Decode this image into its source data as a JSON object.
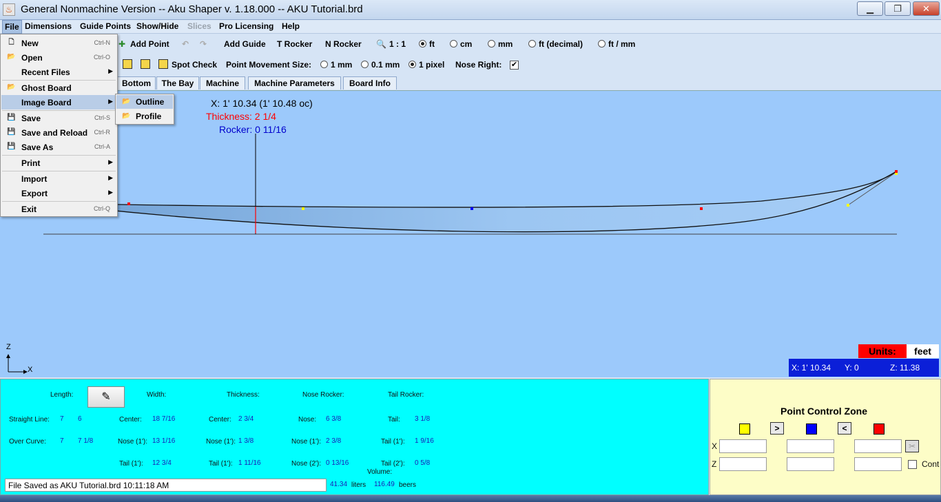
{
  "window": {
    "title": "General Nonmachine Version -- Aku Shaper v. 1.18.000  --  AKU Tutorial.brd",
    "minimize_icon": "minimize-icon",
    "maximize_icon": "restore-icon",
    "close_icon": "close-icon"
  },
  "menubar": {
    "items": [
      "File",
      "Dimensions",
      "Guide Points",
      "Show/Hide",
      "Slices",
      "Pro Licensing",
      "Help"
    ]
  },
  "toolbar1": {
    "add_point": "Add Point",
    "add_guide": "Add Guide",
    "t_rocker": "T Rocker",
    "n_rocker": "N Rocker",
    "zoom": "1 : 1",
    "units": [
      "ft",
      "cm",
      "mm",
      "ft (decimal)",
      "ft / mm"
    ],
    "selected_unit": "ft"
  },
  "toolbar2": {
    "spot_check": "Spot Check",
    "point_movement_label": "Point Movement Size:",
    "movement_options": [
      "1 mm",
      "0.1 mm",
      "1 pixel"
    ],
    "selected_movement": "1 pixel",
    "nose_right_label": "Nose Right:",
    "nose_right_checked": true
  },
  "tabs": [
    "Bottom",
    "The Bay",
    "Machine",
    "Machine Parameters",
    "Board Info"
  ],
  "canvas": {
    "x_readout": "X: 1' 10.34 (1' 10.48 oc)",
    "thickness_readout": "Thickness: 2 1/4",
    "rocker_readout": "Rocker: 0 11/16",
    "axis_z": "Z",
    "axis_x": "X",
    "units_label": "Units:",
    "units_value": "feet",
    "coord_x": "X: 1' 10.34",
    "coord_y": "Y: 0",
    "coord_z": "Z: 11.38"
  },
  "info": {
    "length_label": "Length:",
    "width_label": "Width:",
    "thickness_label": "Thickness:",
    "nose_rocker_label": "Nose Rocker:",
    "tail_rocker_label": "Tail Rocker:",
    "straight_line_label": "Straight Line:",
    "straight_line_a": "7",
    "straight_line_b": "6",
    "over_curve_label": "Over Curve:",
    "over_curve_a": "7",
    "over_curve_b": "7 1/8",
    "width_center_label": "Center:",
    "width_center": "18 7/16",
    "width_nose_label": "Nose (1'):",
    "width_nose": "13 1/16",
    "width_tail_label": "Tail (1'):",
    "width_tail": "12 3/4",
    "thick_center_label": "Center:",
    "thick_center": "2 3/4",
    "thick_nose_label": "Nose (1'):",
    "thick_nose": "1 3/8",
    "thick_tail_label": "Tail (1'):",
    "thick_tail": "1 11/16",
    "nrock_nose_label": "Nose:",
    "nrock_nose": "6 3/8",
    "nrock_nose1_label": "Nose (1'):",
    "nrock_nose1": "2 3/8",
    "nrock_nose2_label": "Nose (2'):",
    "nrock_nose2": "0 13/16",
    "trock_tail_label": "Tail:",
    "trock_tail": "3 1/8",
    "trock_tail1_label": "Tail (1'):",
    "trock_tail1": "1 9/16",
    "trock_tail2_label": "Tail (2'):",
    "trock_tail2": "0 5/8",
    "volume_label": "Volume:",
    "volume_liters": "41.34",
    "liters_label": "liters",
    "volume_beers": "116.49",
    "beers_label": "beers",
    "status": "File Saved as  AKU Tutorial.brd   10:11:18 AM"
  },
  "pcz": {
    "title": "Point Control Zone",
    "x_label": "X",
    "z_label": "Z",
    "cont_label": "Cont",
    "colors": {
      "yellow": "#ffff00",
      "blue": "#0000ff",
      "red": "#ff0000"
    }
  },
  "filemenu": {
    "items": [
      {
        "label": "New",
        "shortcut": "Ctrl-N"
      },
      {
        "label": "Open",
        "shortcut": "Ctrl-O"
      },
      {
        "label": "Recent Files",
        "shortcut": ""
      },
      {
        "label": "Ghost Board",
        "shortcut": ""
      },
      {
        "label": "Image Board",
        "shortcut": ""
      },
      {
        "label": "Save",
        "shortcut": "Ctrl-S"
      },
      {
        "label": "Save and Reload",
        "shortcut": "Ctrl-R"
      },
      {
        "label": "Save As",
        "shortcut": "Ctrl-A"
      },
      {
        "label": "Print",
        "shortcut": ""
      },
      {
        "label": "Import",
        "shortcut": ""
      },
      {
        "label": "Export",
        "shortcut": ""
      },
      {
        "label": "Exit",
        "shortcut": "Ctrl-Q"
      }
    ],
    "submenu": [
      "Outline",
      "Profile"
    ]
  }
}
